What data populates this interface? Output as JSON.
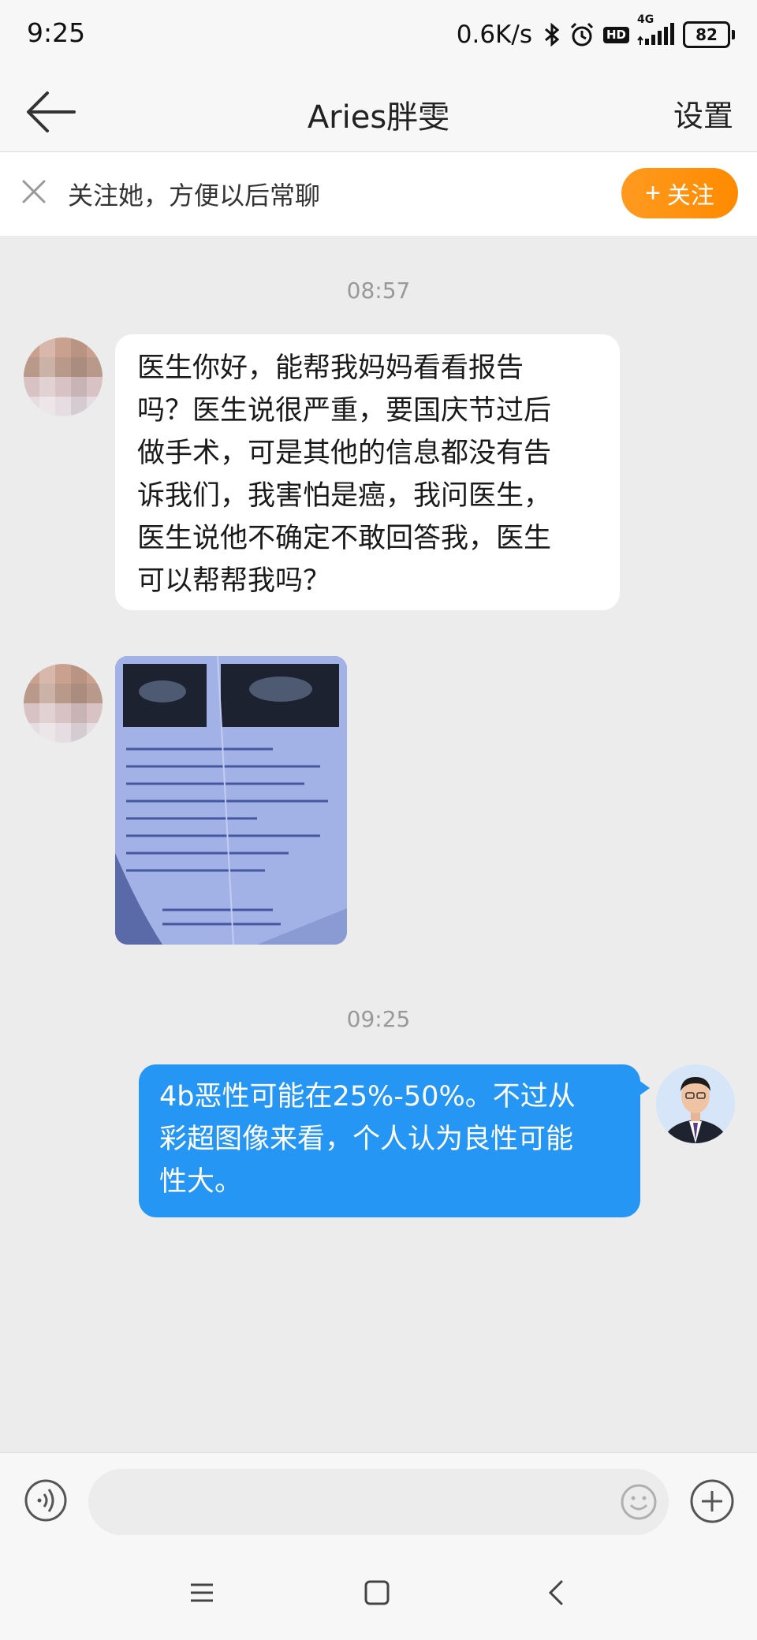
{
  "status_bar": {
    "time": "9:25",
    "network_speed": "0.6K/s",
    "hd_label": "HD",
    "network_type": "4G",
    "battery": "82"
  },
  "header": {
    "title": "Aries胖雯",
    "settings_label": "设置"
  },
  "follow_banner": {
    "text": "关注她，方便以后常聊",
    "button_label": "关注",
    "button_color": "#ff9410"
  },
  "messages": [
    {
      "type": "timestamp",
      "text": "08:57"
    },
    {
      "type": "received_text",
      "lines": [
        "医生你好，能帮我妈妈看看报告",
        "吗？医生说很严重，要国庆节过后",
        "做手术，可是其他的信息都没有告",
        "诉我们，我害怕是癌，我问医生，",
        "医生说他不确定不敢回答我，医生",
        "可以帮帮我吗？"
      ]
    },
    {
      "type": "received_image",
      "icon": "report-photo"
    },
    {
      "type": "timestamp",
      "text": "09:25"
    },
    {
      "type": "sent_text",
      "lines": [
        "4b恶性可能在25%-50%。不过从",
        "彩超图像来看，个人认为良性可能",
        "性大。"
      ],
      "bubble_color": "#2596f3"
    }
  ],
  "input": {
    "placeholder": ""
  },
  "icons": {
    "back": "arrow-left-icon",
    "close": "close-icon",
    "voice": "voice-icon",
    "emoji": "emoji-icon",
    "plus": "plus-icon",
    "menu": "menu-icon",
    "home": "home-icon",
    "back_nav": "chevron-left-icon"
  }
}
